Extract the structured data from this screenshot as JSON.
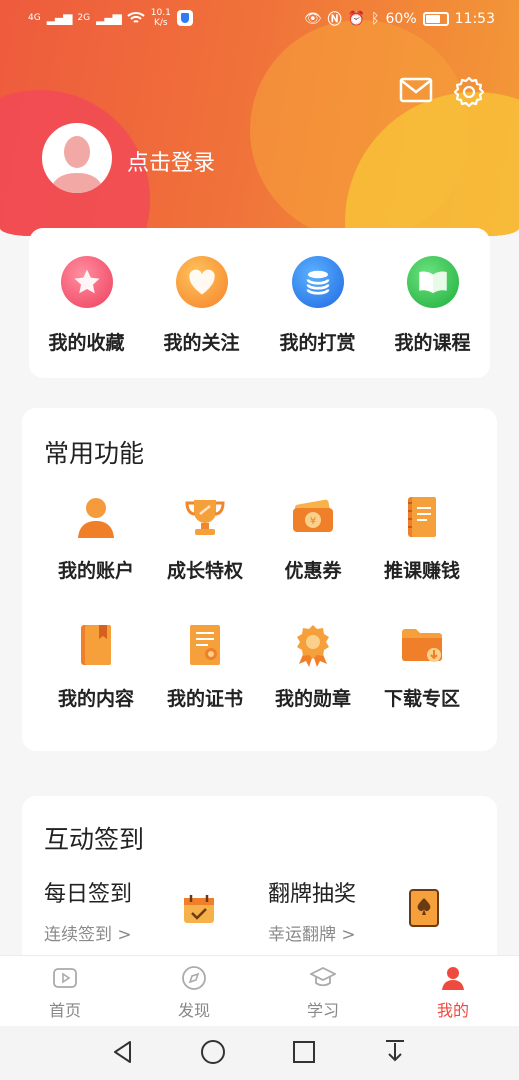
{
  "status": {
    "net1": "4G",
    "net2": "2G",
    "speed_value": "10.1",
    "speed_unit": "K/s",
    "battery": "60%",
    "time": "11:53"
  },
  "header": {
    "login_text": "点击登录"
  },
  "quick": [
    {
      "label": "我的收藏",
      "icon": "star-icon",
      "color": "#f3556b"
    },
    {
      "label": "我的关注",
      "icon": "heart-icon",
      "color": "#f7932d"
    },
    {
      "label": "我的打赏",
      "icon": "coins-icon",
      "color": "#2f7cf0"
    },
    {
      "label": "我的课程",
      "icon": "book-icon",
      "color": "#2dc24d"
    }
  ],
  "common": {
    "title": "常用功能",
    "items": [
      {
        "label": "我的账户",
        "icon": "user-icon"
      },
      {
        "label": "成长特权",
        "icon": "trophy-icon"
      },
      {
        "label": "优惠券",
        "icon": "coupon-icon"
      },
      {
        "label": "推课赚钱",
        "icon": "notebook-icon"
      },
      {
        "label": "我的内容",
        "icon": "content-book-icon"
      },
      {
        "label": "我的证书",
        "icon": "certificate-icon"
      },
      {
        "label": "我的勋章",
        "icon": "medal-icon"
      },
      {
        "label": "下载专区",
        "icon": "download-folder-icon"
      }
    ]
  },
  "interact": {
    "title": "互动签到",
    "checkin": {
      "title": "每日签到",
      "sub": "连续签到 >"
    },
    "lottery": {
      "title": "翻牌抽奖",
      "sub": "幸运翻牌 >"
    }
  },
  "tabs": [
    {
      "label": "首页",
      "icon": "home-icon"
    },
    {
      "label": "发现",
      "icon": "compass-icon"
    },
    {
      "label": "学习",
      "icon": "graduation-cap-icon"
    },
    {
      "label": "我的",
      "icon": "profile-icon",
      "active": true
    }
  ],
  "colors": {
    "accent": "#ef4a3e",
    "orange": "#f39a37"
  }
}
